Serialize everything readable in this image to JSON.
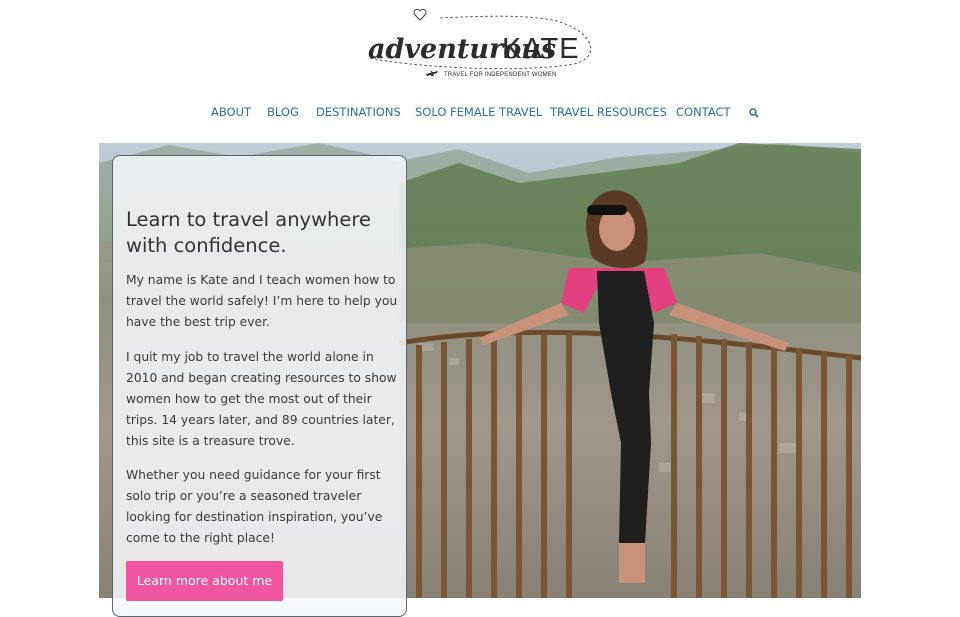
{
  "logo": {
    "brand": "adventurous KATE",
    "script_word": "adventurous",
    "name_word": "KATE",
    "tagline": "TRAVEL FOR INDEPENDENT WOMEN"
  },
  "nav": {
    "items": [
      {
        "label": "ABOUT"
      },
      {
        "label": "BLOG"
      },
      {
        "label": "DESTINATIONS"
      },
      {
        "label": "SOLO FEMALE TRAVEL"
      },
      {
        "label": "TRAVEL RESOURCES"
      },
      {
        "label": "CONTACT"
      }
    ],
    "search_icon": "search-icon"
  },
  "hero": {
    "image": "woman-on-overlook-photo",
    "card": {
      "heading": "Learn to travel anywhere with confidence.",
      "paragraphs": [
        "My name is Kate and I teach women how to travel the world safely! I’m here to help you have the best trip ever.",
        "I quit my job to travel the world alone in 2010 and began creating resources to show women how to get the most out of their trips. 14 years later, and 89 countries later, this site is a treasure trove.",
        "Whether you need guidance for your first solo trip or you’re a seasoned traveler looking for destination inspiration, you’ve come to the right place!"
      ],
      "button_label": "Learn more about me"
    }
  },
  "colors": {
    "nav_link": "#2a6fa8",
    "button": "#f0569f",
    "logo_ink": "#2b2b2b"
  }
}
